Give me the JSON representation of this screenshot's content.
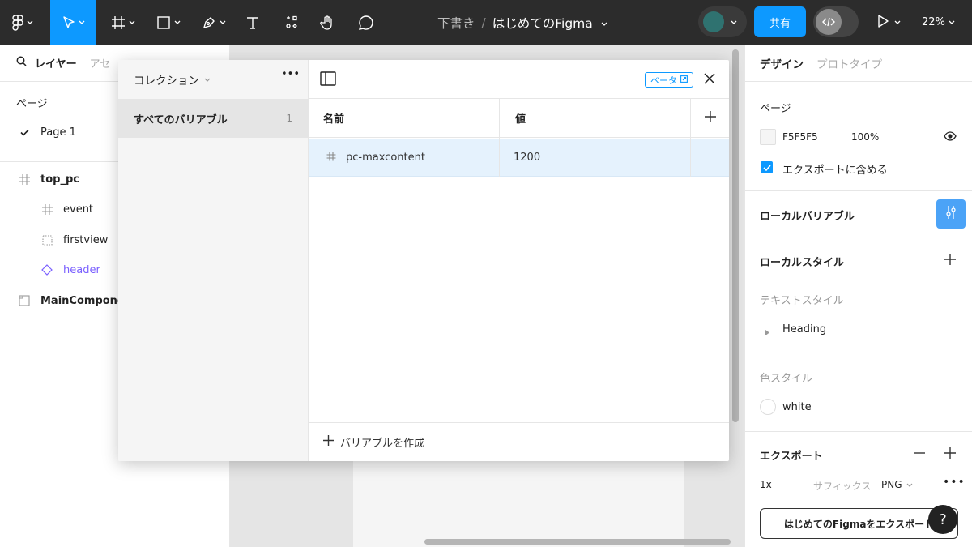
{
  "toolbar": {
    "file_draft": "下書き",
    "file_separator": "/",
    "file_name": "はじめてのFigma",
    "share_label": "共有",
    "zoom_label": "22%"
  },
  "layers_panel": {
    "tab_layers": "レイヤー",
    "tab_assets": "アセ",
    "pages_label": "ページ",
    "pages": [
      {
        "label": "Page 1",
        "selected": true
      }
    ],
    "layers": [
      {
        "label": "top_pc",
        "icon": "frame-icon"
      },
      {
        "label": "event",
        "icon": "frame-icon"
      },
      {
        "label": "firstview",
        "icon": "dashed-frame-icon"
      },
      {
        "label": "header",
        "icon": "component-instance-icon"
      },
      {
        "label": "MainComponen",
        "icon": "section-icon"
      }
    ]
  },
  "variables_modal": {
    "collections_label": "コレクション",
    "collection_item": {
      "label": "すべてのバリアブル",
      "count": "1"
    },
    "beta_label": "ベータ",
    "columns": {
      "name": "名前",
      "value": "値"
    },
    "rows": [
      {
        "name": "pc-maxcontent",
        "value": "1200",
        "type_icon": "number-hash-icon"
      }
    ],
    "create_label": "バリアブルを作成"
  },
  "design_panel": {
    "tab_design": "デザイン",
    "tab_prototype": "プロトタイプ",
    "page_section": "ページ",
    "page_color": "F5F5F5",
    "page_opacity": "100%",
    "include_export_label": "エクスポートに含める",
    "include_export_checked": true,
    "local_variables_label": "ローカルバリアブル",
    "local_styles_label": "ローカルスタイル",
    "text_styles_label": "テキストスタイル",
    "text_styles": [
      {
        "label": "Heading"
      }
    ],
    "color_styles_label": "色スタイル",
    "color_styles": [
      {
        "label": "white",
        "color": "#ffffff"
      }
    ],
    "export_label": "エクスポート",
    "export_scale": "1x",
    "export_suffix_placeholder": "サフィックス",
    "export_format": "PNG",
    "export_button_label": "はじめてのFigmaをエクスポート",
    "help_label": "?"
  },
  "colors": {
    "accent": "#0d99ff",
    "toolbar_bg": "#2c2c2c",
    "avatar": "#2f7270",
    "selected_row": "#e5f2fd"
  }
}
